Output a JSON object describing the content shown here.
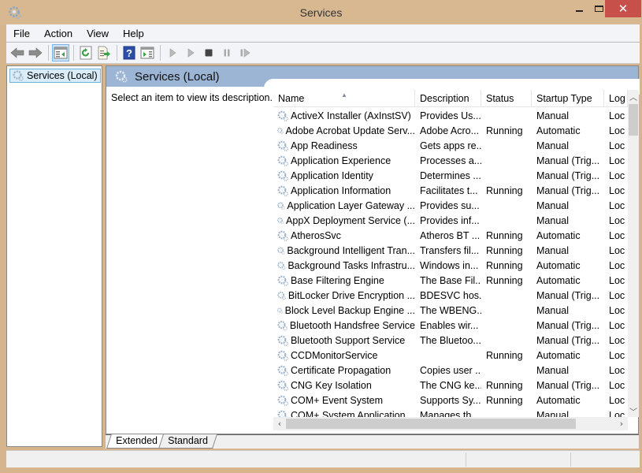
{
  "window": {
    "title": "Services",
    "controls": {
      "minimize": "minimize",
      "maximize": "maximize",
      "close": "✕"
    }
  },
  "menu": [
    "File",
    "Action",
    "View",
    "Help"
  ],
  "toolbar": {
    "buttons": [
      "back",
      "forward",
      "show-hide-console-tree",
      "refresh",
      "export-list",
      "help",
      "show-hide-action-pane",
      "start-service",
      "start-service-alt",
      "stop-service",
      "pause-service",
      "restart-service"
    ]
  },
  "tree": {
    "selected": "Services (Local)"
  },
  "panel": {
    "title": "Services (Local)",
    "description_hint": "Select an item to view its description."
  },
  "list": {
    "columns": [
      "Name",
      "Description",
      "Status",
      "Startup Type",
      "Log"
    ],
    "sort_column": "Name",
    "rows": [
      {
        "name": "ActiveX Installer (AxInstSV)",
        "desc": "Provides Us...",
        "status": "",
        "startup": "Manual",
        "log": "Loc"
      },
      {
        "name": "Adobe Acrobat Update Serv...",
        "desc": "Adobe Acro...",
        "status": "Running",
        "startup": "Automatic",
        "log": "Loc"
      },
      {
        "name": "App Readiness",
        "desc": "Gets apps re...",
        "status": "",
        "startup": "Manual",
        "log": "Loc"
      },
      {
        "name": "Application Experience",
        "desc": "Processes a...",
        "status": "",
        "startup": "Manual (Trig...",
        "log": "Loc"
      },
      {
        "name": "Application Identity",
        "desc": "Determines ...",
        "status": "",
        "startup": "Manual (Trig...",
        "log": "Loc"
      },
      {
        "name": "Application Information",
        "desc": "Facilitates t...",
        "status": "Running",
        "startup": "Manual (Trig...",
        "log": "Loc"
      },
      {
        "name": "Application Layer Gateway ...",
        "desc": "Provides su...",
        "status": "",
        "startup": "Manual",
        "log": "Loc"
      },
      {
        "name": "AppX Deployment Service (...",
        "desc": "Provides inf...",
        "status": "",
        "startup": "Manual",
        "log": "Loc"
      },
      {
        "name": "AtherosSvc",
        "desc": "Atheros BT ...",
        "status": "Running",
        "startup": "Automatic",
        "log": "Loc"
      },
      {
        "name": "Background Intelligent Tran...",
        "desc": "Transfers fil...",
        "status": "Running",
        "startup": "Manual",
        "log": "Loc"
      },
      {
        "name": "Background Tasks Infrastru...",
        "desc": "Windows in...",
        "status": "Running",
        "startup": "Automatic",
        "log": "Loc"
      },
      {
        "name": "Base Filtering Engine",
        "desc": "The Base Fil...",
        "status": "Running",
        "startup": "Automatic",
        "log": "Loc"
      },
      {
        "name": "BitLocker Drive Encryption ...",
        "desc": "BDESVC hos...",
        "status": "",
        "startup": "Manual (Trig...",
        "log": "Loc"
      },
      {
        "name": "Block Level Backup Engine ...",
        "desc": "The WBENG...",
        "status": "",
        "startup": "Manual",
        "log": "Loc"
      },
      {
        "name": "Bluetooth Handsfree Service",
        "desc": "Enables wir...",
        "status": "",
        "startup": "Manual (Trig...",
        "log": "Loc"
      },
      {
        "name": "Bluetooth Support Service",
        "desc": "The Bluetoo...",
        "status": "",
        "startup": "Manual (Trig...",
        "log": "Loc"
      },
      {
        "name": "CCDMonitorService",
        "desc": "",
        "status": "Running",
        "startup": "Automatic",
        "log": "Loc"
      },
      {
        "name": "Certificate Propagation",
        "desc": "Copies user ...",
        "status": "",
        "startup": "Manual",
        "log": "Loc"
      },
      {
        "name": "CNG Key Isolation",
        "desc": "The CNG ke...",
        "status": "Running",
        "startup": "Manual (Trig...",
        "log": "Loc"
      },
      {
        "name": "COM+ Event System",
        "desc": "Supports Sy...",
        "status": "Running",
        "startup": "Automatic",
        "log": "Loc"
      },
      {
        "name": "COM+ System Application",
        "desc": "Manages th...",
        "status": "",
        "startup": "Manual",
        "log": "Loc"
      }
    ]
  },
  "tabs": [
    "Extended",
    "Standard"
  ],
  "active_tab": "Extended",
  "colors": {
    "title_bar": "#d8b891",
    "close_button": "#c7504a",
    "panel_header": "#9db5d4",
    "selection": "#d9ecf8"
  }
}
